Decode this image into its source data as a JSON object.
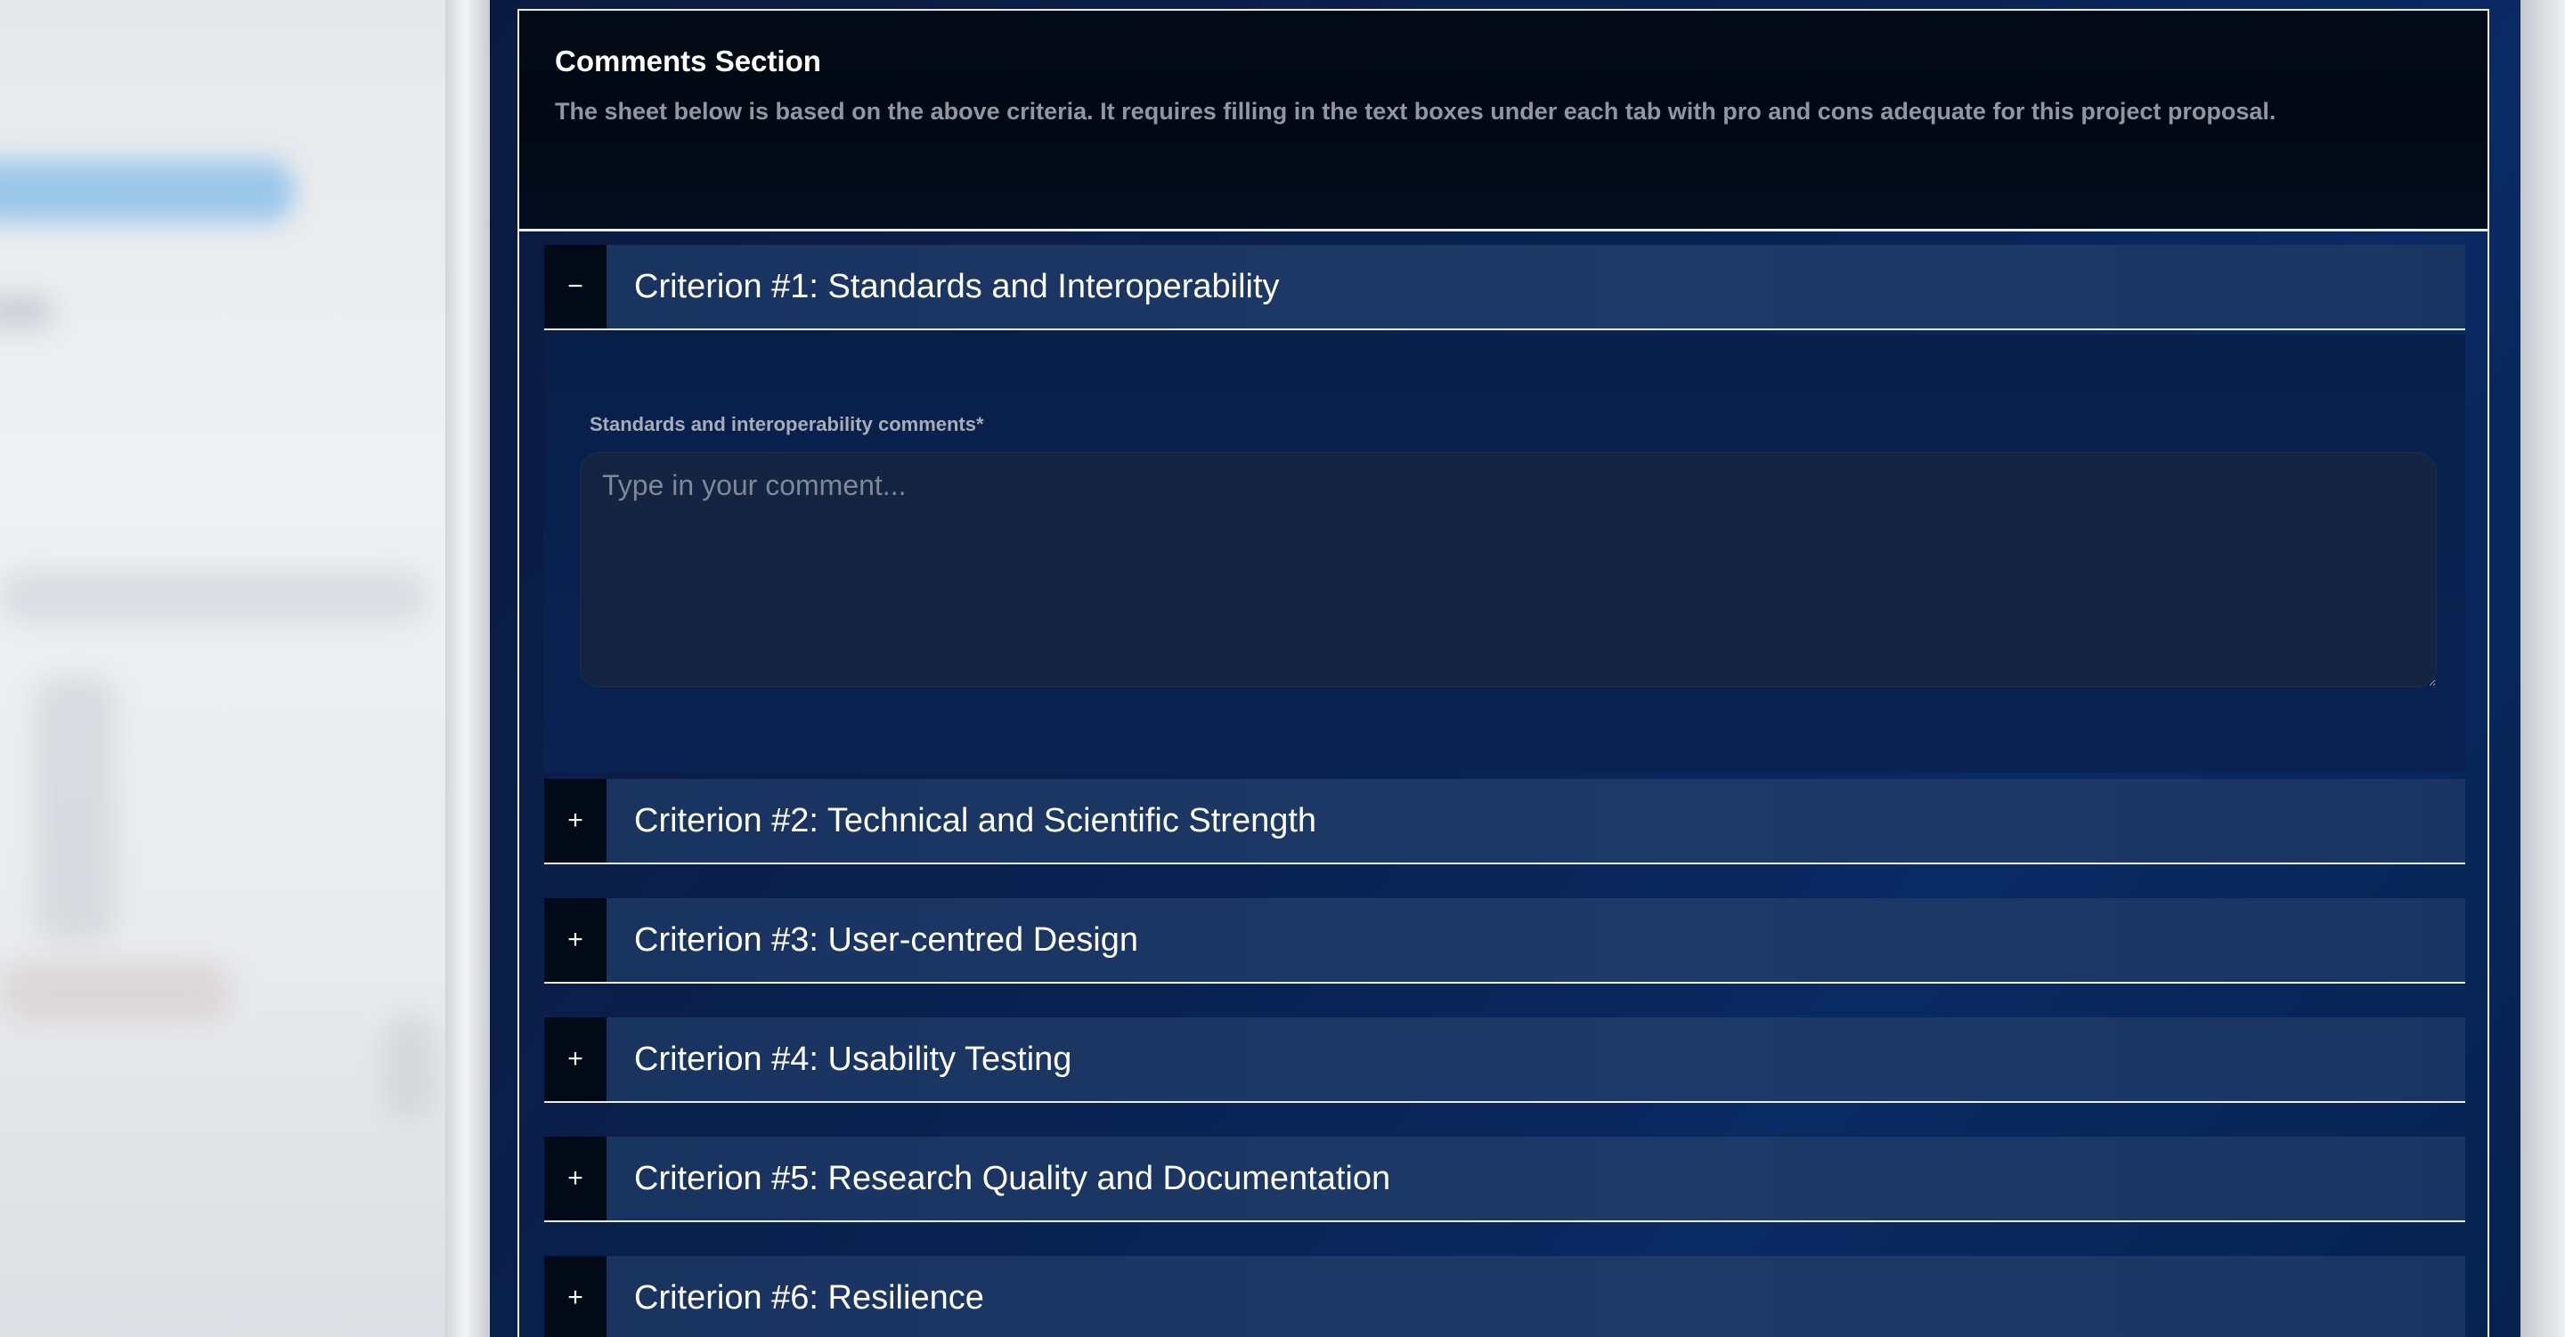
{
  "comments_section": {
    "title": "Comments Section",
    "description": "The sheet below is based on the above criteria. It requires filling in the text boxes under each tab with pro and cons adequate for this project proposal."
  },
  "criteria": [
    {
      "toggle": "−",
      "label": "Criterion #1: Standards and Interoperability",
      "expanded": true
    },
    {
      "toggle": "+",
      "label": "Criterion #2: Technical and Scientific Strength",
      "expanded": false
    },
    {
      "toggle": "+",
      "label": "Criterion #3: User-centred Design",
      "expanded": false
    },
    {
      "toggle": "+",
      "label": "Criterion #4: Usability Testing",
      "expanded": false
    },
    {
      "toggle": "+",
      "label": "Criterion #5: Research Quality and Documentation",
      "expanded": false
    },
    {
      "toggle": "+",
      "label": "Criterion #6: Resilience",
      "expanded": false
    }
  ],
  "criterion1_panel": {
    "field_label": "Standards and interoperability comments*",
    "placeholder": "Type in your comment...",
    "value": ""
  },
  "colors": {
    "page_background": "#0a2352",
    "header_background": "#030a17",
    "accordion_background": "#1d3a66",
    "toggle_background": "#020a18",
    "border": "#e9eef5"
  }
}
